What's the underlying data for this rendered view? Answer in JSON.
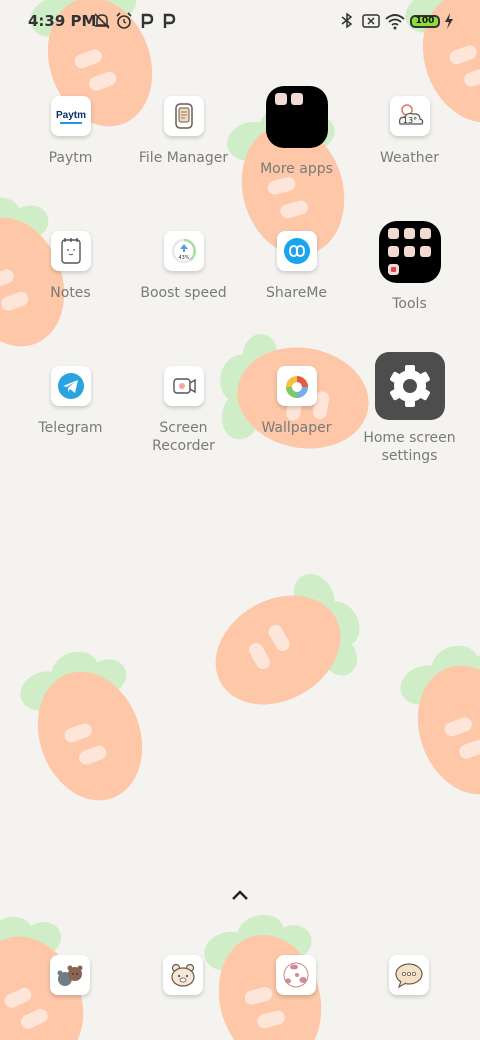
{
  "status_bar": {
    "time": "4:39 PM",
    "battery": "100",
    "icons": [
      "notifications-off-icon",
      "alarm-icon",
      "p-app-icon",
      "p-app-icon",
      "bluetooth-icon",
      "sim-error-icon",
      "wifi-icon",
      "battery-icon",
      "charging-icon"
    ]
  },
  "apps": [
    {
      "label": "Paytm",
      "icon": "paytm-icon",
      "logo_text": "Paytm"
    },
    {
      "label": "File Manager",
      "icon": "file-manager-icon"
    },
    {
      "label": "More apps",
      "icon": "folder-icon"
    },
    {
      "label": "Weather",
      "icon": "weather-icon",
      "temp": "13°"
    },
    {
      "label": "Notes",
      "icon": "notes-icon"
    },
    {
      "label": "Boost speed",
      "icon": "boost-speed-icon",
      "percent": "43%"
    },
    {
      "label": "ShareMe",
      "icon": "shareme-icon"
    },
    {
      "label": "Tools",
      "icon": "folder-icon"
    },
    {
      "label": "Telegram",
      "icon": "telegram-icon"
    },
    {
      "label": "Screen\nRecorder",
      "icon": "screen-recorder-icon"
    },
    {
      "label": "Wallpaper",
      "icon": "wallpaper-icon"
    },
    {
      "label": "Home screen\nsettings",
      "icon": "gear-icon"
    }
  ],
  "dock": [
    {
      "icon": "bears-icon"
    },
    {
      "icon": "bear-face-icon"
    },
    {
      "icon": "camera-icon"
    },
    {
      "icon": "chat-bubble-icon"
    }
  ],
  "colors": {
    "background": "#f4f3f0",
    "carrot": "#fdc7a8",
    "leaf": "#cfeec7",
    "label_text": "#7a7a7a"
  }
}
